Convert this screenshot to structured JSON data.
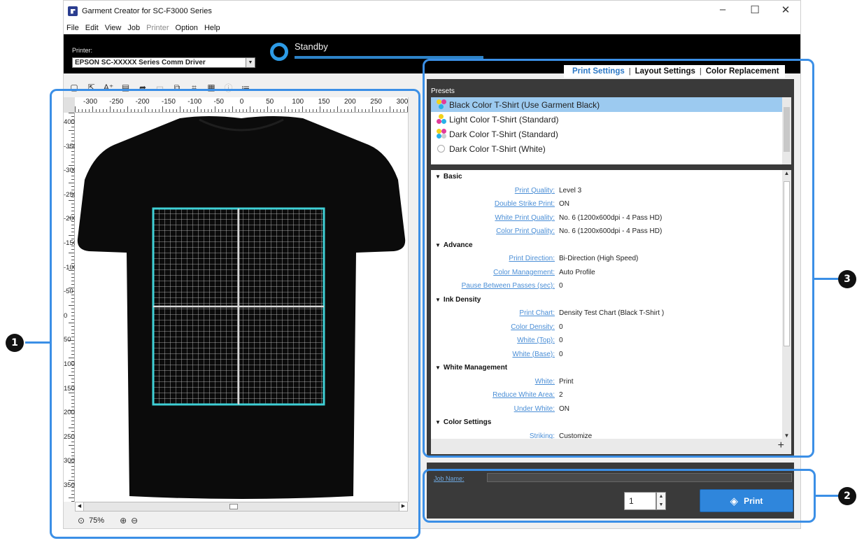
{
  "window": {
    "title": "Garment Creator for SC-F3000 Series",
    "controls": {
      "minimize": "–",
      "maximize": "☐",
      "close": "✕"
    }
  },
  "menu": [
    "File",
    "Edit",
    "View",
    "Job",
    "Printer",
    "Option",
    "Help"
  ],
  "menu_disabled": [
    "Printer"
  ],
  "printer": {
    "label": "Printer:",
    "selected": "EPSON SC-XXXXX Series Comm Driver"
  },
  "status": {
    "text": "Standby"
  },
  "tabs": [
    "Print Settings",
    "Layout Settings",
    "Color Replacement"
  ],
  "tab_separator": "|",
  "ruler": {
    "top_labels": [
      "-300",
      "-250",
      "-200",
      "-150",
      "-100",
      "-50",
      "0",
      "50",
      "100",
      "150",
      "200",
      "250",
      "300"
    ],
    "left_labels": [
      "400",
      "-350",
      "-300",
      "-250",
      "-200",
      "-150",
      "-100",
      "-50",
      "0",
      "50",
      "100",
      "150",
      "200",
      "250",
      "300",
      "350"
    ]
  },
  "zoom": {
    "value": "75%"
  },
  "presets": {
    "label": "Presets",
    "items": [
      {
        "label": "Black Color T-Shirt (Use Garment Black)",
        "selected": true
      },
      {
        "label": "Light Color T-Shirt (Standard)",
        "selected": false
      },
      {
        "label": "Dark Color T-Shirt (Standard)",
        "selected": false
      },
      {
        "label": "Dark Color T-Shirt (White)",
        "selected": false
      }
    ]
  },
  "settings": {
    "sections": [
      {
        "title": "Basic",
        "rows": [
          {
            "key": "Print Quality:",
            "value": "Level 3"
          },
          {
            "key": "Double Strike Print:",
            "value": "ON"
          },
          {
            "key": "White Print Quality:",
            "value": "No. 6 (1200x600dpi - 4 Pass HD)"
          },
          {
            "key": "Color Print Quality:",
            "value": "No. 6 (1200x600dpi - 4 Pass HD)"
          }
        ]
      },
      {
        "title": "Advance",
        "rows": [
          {
            "key": "Print Direction:",
            "value": "Bi-Direction (High Speed)"
          },
          {
            "key": "Color Management:",
            "value": "Auto Profile"
          },
          {
            "key": "Pause Between Passes (sec):",
            "value": "0"
          }
        ]
      },
      {
        "title": "Ink Density",
        "rows": [
          {
            "key": "Print Chart:",
            "value": "Density Test Chart (Black T-Shirt )"
          },
          {
            "key": "Color Density:",
            "value": "0"
          },
          {
            "key": "White (Top):",
            "value": "0"
          },
          {
            "key": "White (Base):",
            "value": "0"
          }
        ]
      },
      {
        "title": "White Management",
        "rows": [
          {
            "key": "White:",
            "value": "Print"
          },
          {
            "key": "Reduce White Area:",
            "value": "2"
          },
          {
            "key": "Under White:",
            "value": "ON"
          }
        ]
      },
      {
        "title": "Color Settings",
        "rows": [
          {
            "key": "Striking:",
            "value": "Customize"
          }
        ]
      }
    ],
    "add_label": "+"
  },
  "print_panel": {
    "job_label": "Job Name:",
    "job_name": "",
    "copies": "1",
    "print_label": "Print"
  },
  "callouts": [
    "1",
    "2",
    "3"
  ],
  "colors": {
    "accent": "#3b8fe6",
    "print_button": "#2f86dc",
    "selected_preset": "#9ccaf0",
    "print_area": "#3fd0d6"
  }
}
